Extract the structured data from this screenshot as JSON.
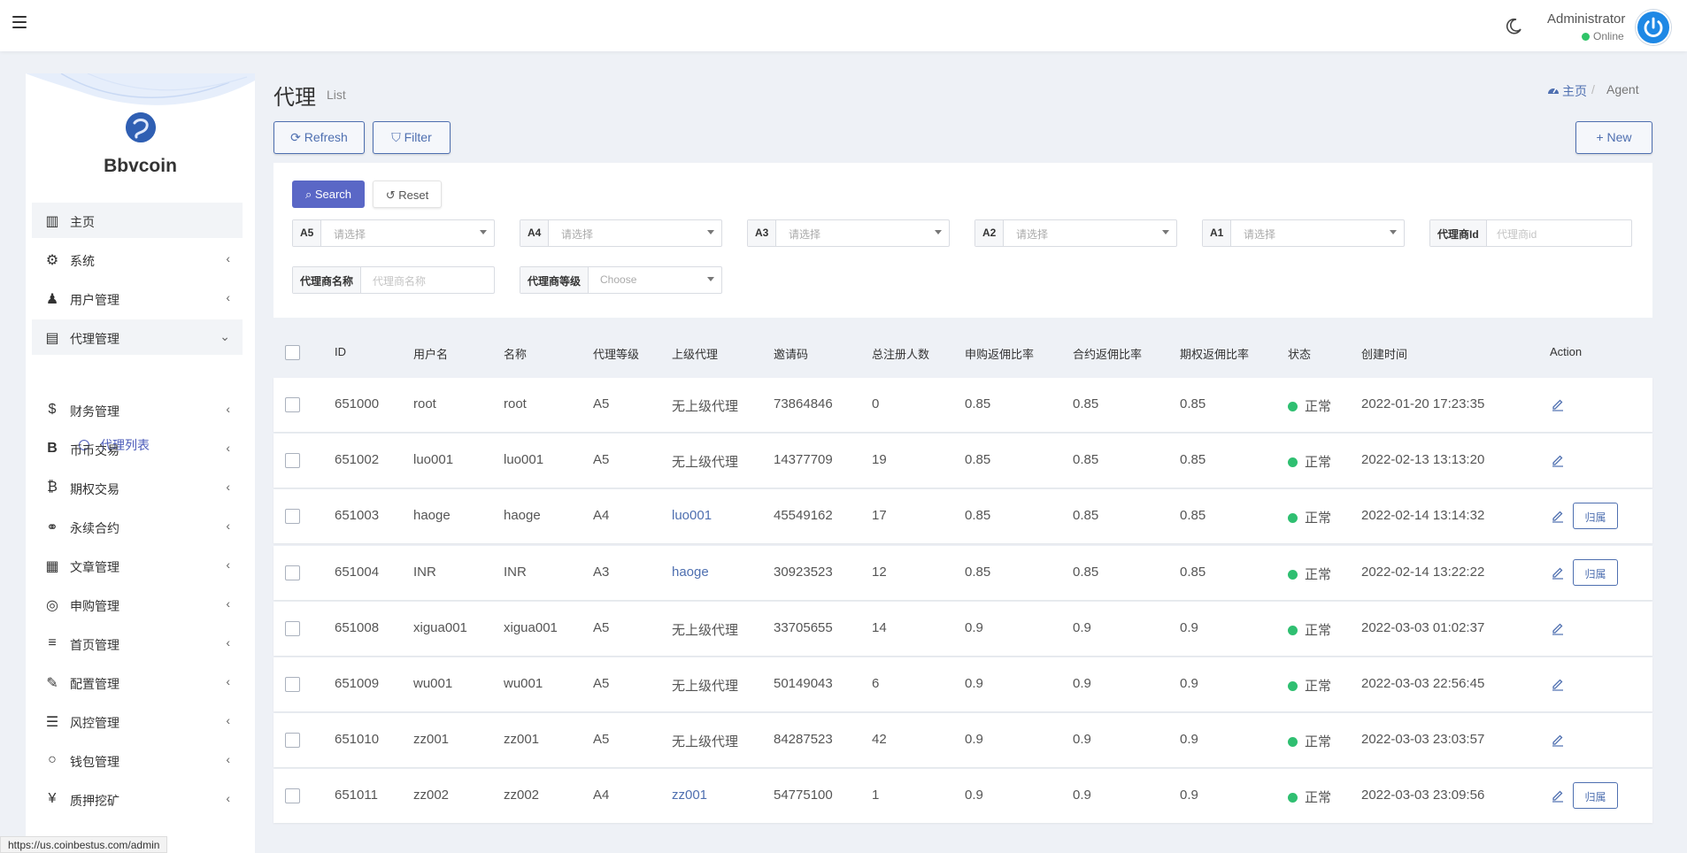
{
  "header": {
    "admin_name": "Administrator",
    "admin_status": "Online"
  },
  "sidebar": {
    "brand": "Bbvcoin",
    "items": [
      {
        "label": "主页",
        "icon": "bar-chart-icon"
      },
      {
        "label": "系统",
        "icon": "gear-icon"
      },
      {
        "label": "用户管理",
        "icon": "user-icon"
      },
      {
        "label": "代理管理",
        "icon": "id-card-icon"
      },
      {
        "label": "财务管理",
        "icon": "dollar-icon"
      },
      {
        "label": "币币交易",
        "icon": "bitcoin-b-icon"
      },
      {
        "label": "期权交易",
        "icon": "bitcoin-icon"
      },
      {
        "label": "永续合约",
        "icon": "link-icon"
      },
      {
        "label": "文章管理",
        "icon": "newspaper-icon"
      },
      {
        "label": "申购管理",
        "icon": "lifebuoy-icon"
      },
      {
        "label": "首页管理",
        "icon": "list-icon"
      },
      {
        "label": "配置管理",
        "icon": "wrench-icon"
      },
      {
        "label": "风控管理",
        "icon": "indent-icon"
      },
      {
        "label": "钱包管理",
        "icon": "circle-icon"
      },
      {
        "label": "质押挖矿",
        "icon": "yen-icon"
      }
    ],
    "sub_item": "代理列表",
    "status_url": "https://us.coinbestus.com/admin"
  },
  "page": {
    "title": "代理",
    "subtitle": "List",
    "breadcrumb_home": "主页",
    "breadcrumb_current": "Agent"
  },
  "toolbar": {
    "refresh": "Refresh",
    "filter": "Filter",
    "new": "New"
  },
  "filter": {
    "search": "Search",
    "reset": "Reset",
    "fields": [
      {
        "tag": "A5",
        "value": "请选择"
      },
      {
        "tag": "A4",
        "value": "请选择"
      },
      {
        "tag": "A3",
        "value": "请选择"
      },
      {
        "tag": "A2",
        "value": "请选择"
      },
      {
        "tag": "A1",
        "value": "请选择"
      },
      {
        "tag": "代理商Id",
        "value": "代理商id"
      },
      {
        "tag": "代理商名称",
        "value": "代理商名称"
      },
      {
        "tag": "代理商等级",
        "value": "Choose"
      }
    ]
  },
  "table": {
    "columns": [
      "ID",
      "用户名",
      "名称",
      "代理等级",
      "上级代理",
      "邀请码",
      "总注册人数",
      "申购返佣比率",
      "合约返佣比率",
      "期权返佣比率",
      "状态",
      "创建时间",
      "Action"
    ],
    "action_button": "归属",
    "rows": [
      {
        "id": "651000",
        "username": "root",
        "name": "root",
        "level": "A5",
        "parent": "无上级代理",
        "parent_link": false,
        "invite": "73864846",
        "registered": "0",
        "sub_rate": "0.85",
        "contract_rate": "0.85",
        "option_rate": "0.85",
        "status": "正常",
        "created": "2022-01-20 17:23:35",
        "has_assign": false
      },
      {
        "id": "651002",
        "username": "luo001",
        "name": "luo001",
        "level": "A5",
        "parent": "无上级代理",
        "parent_link": false,
        "invite": "14377709",
        "registered": "19",
        "sub_rate": "0.85",
        "contract_rate": "0.85",
        "option_rate": "0.85",
        "status": "正常",
        "created": "2022-02-13 13:13:20",
        "has_assign": false
      },
      {
        "id": "651003",
        "username": "haoge",
        "name": "haoge",
        "level": "A4",
        "parent": "luo001",
        "parent_link": true,
        "invite": "45549162",
        "registered": "17",
        "sub_rate": "0.85",
        "contract_rate": "0.85",
        "option_rate": "0.85",
        "status": "正常",
        "created": "2022-02-14 13:14:32",
        "has_assign": true
      },
      {
        "id": "651004",
        "username": "INR",
        "name": "INR",
        "level": "A3",
        "parent": "haoge",
        "parent_link": true,
        "invite": "30923523",
        "registered": "12",
        "sub_rate": "0.85",
        "contract_rate": "0.85",
        "option_rate": "0.85",
        "status": "正常",
        "created": "2022-02-14 13:22:22",
        "has_assign": true
      },
      {
        "id": "651008",
        "username": "xigua001",
        "name": "xigua001",
        "level": "A5",
        "parent": "无上级代理",
        "parent_link": false,
        "invite": "33705655",
        "registered": "14",
        "sub_rate": "0.9",
        "contract_rate": "0.9",
        "option_rate": "0.9",
        "status": "正常",
        "created": "2022-03-03 01:02:37",
        "has_assign": false
      },
      {
        "id": "651009",
        "username": "wu001",
        "name": "wu001",
        "level": "A5",
        "parent": "无上级代理",
        "parent_link": false,
        "invite": "50149043",
        "registered": "6",
        "sub_rate": "0.9",
        "contract_rate": "0.9",
        "option_rate": "0.9",
        "status": "正常",
        "created": "2022-03-03 22:56:45",
        "has_assign": false
      },
      {
        "id": "651010",
        "username": "zz001",
        "name": "zz001",
        "level": "A5",
        "parent": "无上级代理",
        "parent_link": false,
        "invite": "84287523",
        "registered": "42",
        "sub_rate": "0.9",
        "contract_rate": "0.9",
        "option_rate": "0.9",
        "status": "正常",
        "created": "2022-03-03 23:03:57",
        "has_assign": false
      },
      {
        "id": "651011",
        "username": "zz002",
        "name": "zz002",
        "level": "A4",
        "parent": "zz001",
        "parent_link": true,
        "invite": "54775100",
        "registered": "1",
        "sub_rate": "0.9",
        "contract_rate": "0.9",
        "option_rate": "0.9",
        "status": "正常",
        "created": "2022-03-03 23:09:56",
        "has_assign": true
      }
    ]
  },
  "colors": {
    "accent": "#4e6fb0",
    "primary_button": "#5a67c6",
    "status_ok": "#2fbf71"
  }
}
